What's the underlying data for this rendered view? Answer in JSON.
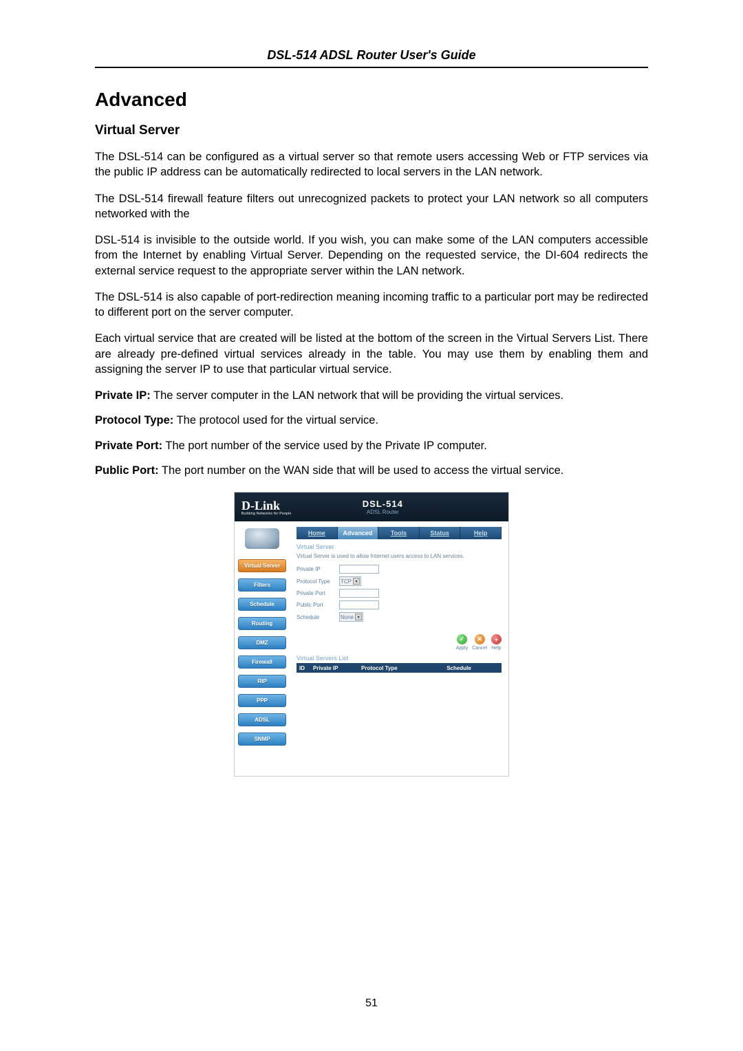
{
  "doc": {
    "header": "DSL-514 ADSL Router User's Guide",
    "page_number": "51",
    "section_title": "Advanced",
    "subsection_title": "Virtual Server",
    "paragraphs": [
      "The DSL-514 can be configured as a virtual server so that remote users accessing Web or FTP services via the public IP address can be automatically redirected to local servers in the LAN network.",
      "The DSL-514 firewall feature filters out unrecognized packets to protect your LAN network so all computers networked with the",
      "DSL-514 is invisible to the outside world. If you wish, you can make some of the LAN computers accessible from the Internet by enabling Virtual Server. Depending on the requested service, the DI-604 redirects the external service request to the appropriate server within the LAN network.",
      "The DSL-514 is also capable of port-redirection meaning incoming traffic to a particular port may be redirected to different port on the server computer.",
      "Each virtual service that are created will be listed at the bottom of the screen in the Virtual Servers List. There are already pre-defined virtual services already in the table. You may use them by enabling them and assigning the server IP to use that particular virtual service."
    ],
    "definitions": [
      {
        "term": "Private IP:",
        "desc": " The server computer in the LAN network that will be providing the virtual services."
      },
      {
        "term": "Protocol Type:",
        "desc": " The protocol used for the virtual service."
      },
      {
        "term": "Private Port:",
        "desc": " The port number of the service used by the Private IP computer."
      },
      {
        "term": "Public Port:",
        "desc": " The port number on the WAN side that will be used to access the virtual service."
      }
    ]
  },
  "router": {
    "brand": "D-Link",
    "tagline": "Building Networks for People",
    "model": "DSL-514",
    "model_sub": "ADSL Router",
    "tabs": [
      "Home",
      "Advanced",
      "Tools",
      "Status",
      "Help"
    ],
    "active_tab": "Advanced",
    "sidebar": [
      {
        "label": "Virtual Server",
        "active": true
      },
      {
        "label": "Filters",
        "active": false
      },
      {
        "label": "Schedule",
        "active": false
      },
      {
        "label": "Routing",
        "active": false
      },
      {
        "label": "DMZ",
        "active": false
      },
      {
        "label": "Firewall",
        "active": false
      },
      {
        "label": "RIP",
        "active": false
      },
      {
        "label": "PPP",
        "active": false
      },
      {
        "label": "ADSL",
        "active": false
      },
      {
        "label": "SNMP",
        "active": false
      }
    ],
    "panel": {
      "title": "Virtual Server",
      "desc": "Virtual Server is used to allow Internet users access to LAN services.",
      "fields": {
        "private_ip_label": "Private IP",
        "private_ip_value": "",
        "protocol_type_label": "Protocol Type",
        "protocol_type_value": "TCP",
        "private_port_label": "Private Port",
        "private_port_value": "",
        "public_port_label": "Public Port",
        "public_port_value": "",
        "schedule_label": "Schedule",
        "schedule_value": "None"
      },
      "actions": {
        "apply": "Apply",
        "cancel": "Cancel",
        "help": "Help"
      },
      "list_title": "Virtual Servers List",
      "list_headers": {
        "id": "ID",
        "ip": "Private IP",
        "proto": "Protocol Type",
        "sched": "Schedule"
      }
    }
  }
}
